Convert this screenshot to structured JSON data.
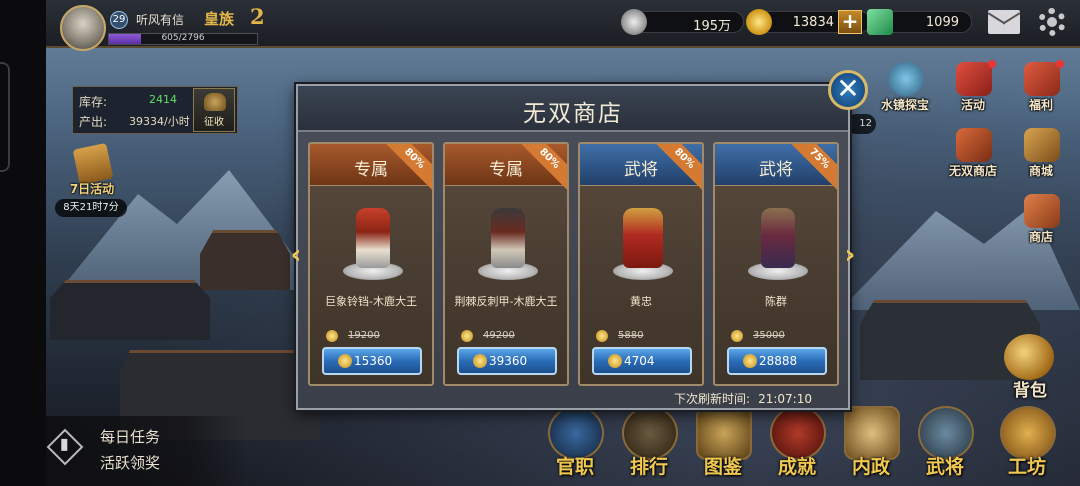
{
  "player": {
    "level": "29",
    "name": "听风有信",
    "rank_label": "皇族",
    "rank_value": "2",
    "exp_text": "605/2796",
    "exp_progress": 0.216
  },
  "resources": {
    "silver": "195万",
    "gold": "13834",
    "jade": "1099"
  },
  "stock": {
    "stock_label": "库存:",
    "stock_value": "2414",
    "output_label": "产出:",
    "output_value": "39334/小时",
    "collect_label": "征收"
  },
  "event7": {
    "label": "7日活动",
    "timer": "8天21时7分"
  },
  "right_icons": {
    "mirror": "水镜探宝",
    "event": "活动",
    "welfare": "福利",
    "wushuang": "无双商店",
    "mall": "商城",
    "store": "商店",
    "map_count": "12"
  },
  "bag_label": "背包",
  "bottom_nav": [
    "官职",
    "排行",
    "图鉴",
    "成就",
    "内政",
    "武将",
    "工坊"
  ],
  "daily": {
    "tasks": "每日任务",
    "active": "活跃领奖"
  },
  "shop": {
    "title": "无双商店",
    "close": "✕",
    "refresh_label": "下次刷新时间:",
    "refresh_time": "21:07:10",
    "items": [
      {
        "type": "专属",
        "discount": "80%",
        "name": "巨象铃铛-木鹿大王",
        "old_price": "19200",
        "price": "15360"
      },
      {
        "type": "专属",
        "discount": "80%",
        "name": "荆棘反刺甲-木鹿大王",
        "old_price": "49200",
        "price": "39360"
      },
      {
        "type": "武将",
        "discount": "80%",
        "name": "黄忠",
        "old_price": "5880",
        "price": "4704"
      },
      {
        "type": "武将",
        "discount": "75%",
        "name": "陈群",
        "old_price": "35000",
        "price": "28888"
      }
    ]
  }
}
